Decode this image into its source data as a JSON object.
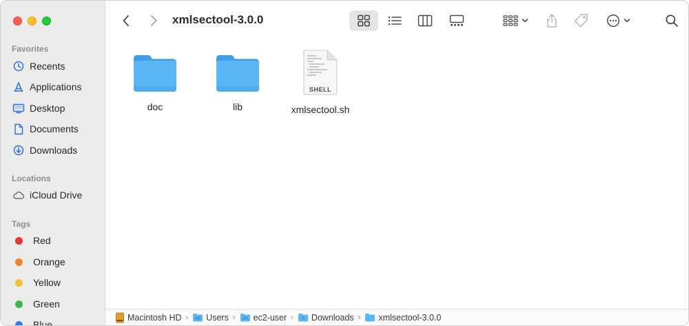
{
  "window": {
    "title": "xmlsectool-3.0.0"
  },
  "sidebar": {
    "favorites_title": "Favorites",
    "favorites": [
      {
        "label": "Recents",
        "icon": "clock-icon"
      },
      {
        "label": "Applications",
        "icon": "applications-icon"
      },
      {
        "label": "Desktop",
        "icon": "desktop-icon"
      },
      {
        "label": "Documents",
        "icon": "document-icon"
      },
      {
        "label": "Downloads",
        "icon": "download-icon"
      }
    ],
    "locations_title": "Locations",
    "locations": [
      {
        "label": "iCloud Drive",
        "icon": "cloud-icon"
      }
    ],
    "tags_title": "Tags",
    "tags": [
      {
        "label": "Red",
        "color": "#e8352f"
      },
      {
        "label": "Orange",
        "color": "#f0862b"
      },
      {
        "label": "Yellow",
        "color": "#efc032"
      },
      {
        "label": "Green",
        "color": "#3bb84c"
      },
      {
        "label": "Blue",
        "color": "#2f7ff0"
      }
    ]
  },
  "files": [
    {
      "name": "doc",
      "kind": "folder"
    },
    {
      "name": "lib",
      "kind": "folder"
    },
    {
      "name": "xmlsectool.sh",
      "kind": "shell",
      "badge": "SHELL"
    }
  ],
  "pathbar": [
    {
      "label": "Macintosh HD",
      "icon": "hard-drive-icon"
    },
    {
      "label": "Users",
      "icon": "folder-icon"
    },
    {
      "label": "ec2-user",
      "icon": "folder-icon"
    },
    {
      "label": "Downloads",
      "icon": "folder-icon"
    },
    {
      "label": "xmlsectool-3.0.0",
      "icon": "folder-icon"
    }
  ],
  "colors": {
    "accent": "#2a6ee8",
    "folder": "#5ab7f3"
  }
}
